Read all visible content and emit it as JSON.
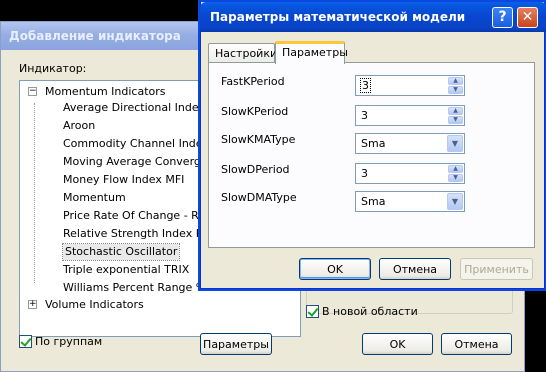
{
  "background_window": {
    "title": "Добавление индикатора",
    "indicator_label": "Индикатор:",
    "tree": {
      "groups": [
        {
          "label": "Momentum Indicators",
          "expander": "⊟"
        },
        {
          "label": "Volume Indicators",
          "expander": "⊞"
        }
      ],
      "items": [
        "Average Directional Index - ADX",
        "Aroon",
        "Commodity Channel Index - CCI",
        "Moving Average Convergence Divergence",
        "Money Flow Index MFI",
        "Momentum",
        "Price Rate Of Change - ROC",
        "Relative Strength Index RSI",
        "Stochastic Oscillator",
        "Triple exponential TRIX",
        "Williams Percent Range %R"
      ],
      "selected_item": "Stochastic Oscillator"
    },
    "by_groups_checkbox": {
      "label": "По группам",
      "checked": true
    },
    "new_area_checkbox": {
      "label": "В новой области",
      "checked": true
    },
    "parameters_button": "Параметры",
    "ok_button": "OK",
    "cancel_button": "Отмена"
  },
  "dialog": {
    "title": "Параметры математической модели",
    "help_glyph": "?",
    "close_glyph": "✕",
    "tabs": [
      {
        "label": "Настройки",
        "active": false
      },
      {
        "label": "Параметры",
        "active": true
      }
    ],
    "params": [
      {
        "label": "FastKPeriod",
        "kind": "spin",
        "value": "3"
      },
      {
        "label": "SlowKPeriod",
        "kind": "spin",
        "value": "3"
      },
      {
        "label": "SlowKMAType",
        "kind": "combo",
        "value": "Sma"
      },
      {
        "label": "SlowDPeriod",
        "kind": "spin",
        "value": "3"
      },
      {
        "label": "SlowDMAType",
        "kind": "combo",
        "value": "Sma"
      }
    ],
    "ok_button": "OK",
    "cancel_button": "Отмена",
    "apply_button": "Применить"
  },
  "colors": {
    "active_title": "#0a4dd6",
    "inactive_title": "#9fb4e6",
    "dialog_face": "#ece9d8",
    "tab_highlight": "#ffc83c"
  }
}
